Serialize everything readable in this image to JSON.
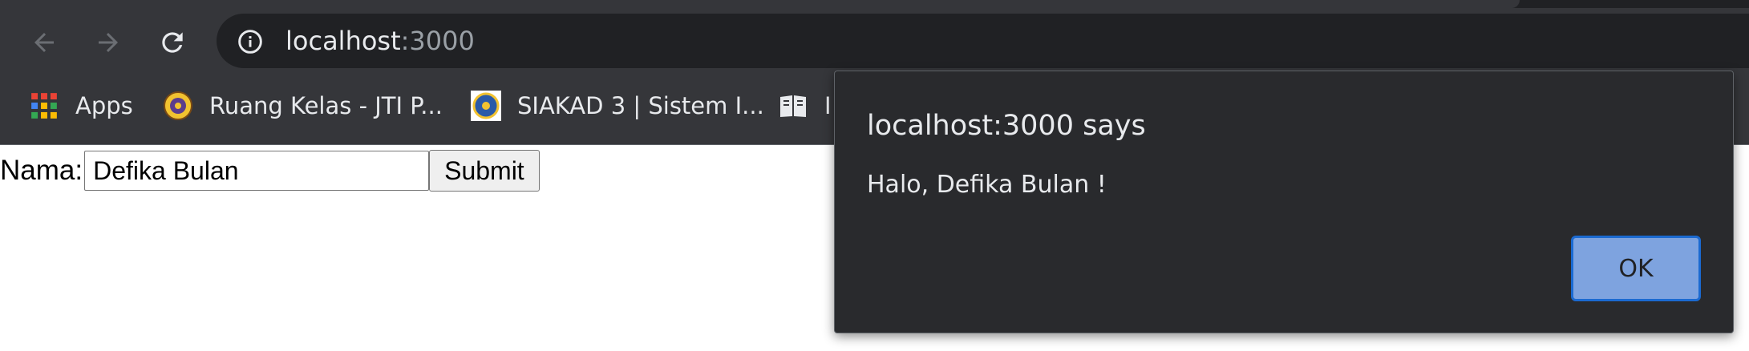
{
  "browser": {
    "address": {
      "host": "localhost",
      "port": ":3000"
    },
    "bookmarks": [
      {
        "label": "Apps",
        "icon": "apps-grid-icon"
      },
      {
        "label": "Ruang Kelas - JTI P...",
        "icon": "university-logo-icon"
      },
      {
        "label": "SIAKAD 3 | Sistem I...",
        "icon": "university-logo-icon"
      },
      {
        "label": "I",
        "icon": "book-icon"
      }
    ]
  },
  "page": {
    "name_label": "Nama:",
    "name_value": "Defika Bulan",
    "submit_label": "Submit"
  },
  "dialog": {
    "title": "localhost:3000 says",
    "message": "Halo, Defika Bulan !",
    "ok_label": "OK"
  }
}
